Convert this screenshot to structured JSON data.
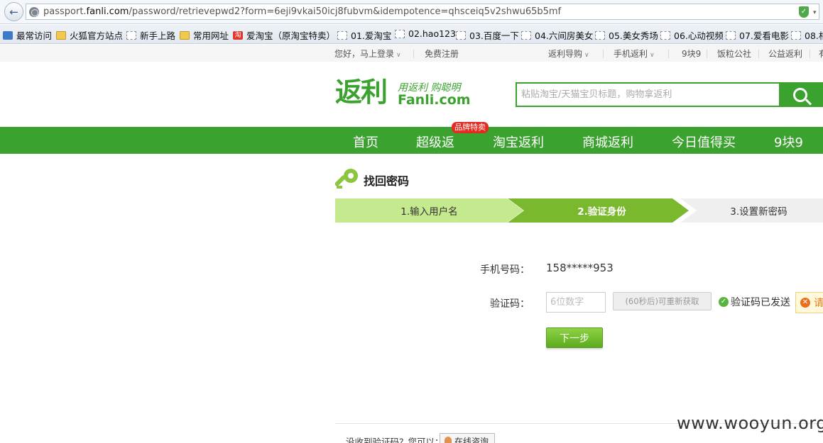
{
  "browser": {
    "url_prefix": "passport.",
    "url_host": "fanli.com",
    "url_path": "/password/retrievepwd2?form=6eji9vkai50icj8fubvm&idempotence=qhsceiq5v2shwu65b5mf"
  },
  "bookmarks": [
    {
      "label": "最常访问"
    },
    {
      "label": "火狐官方站点"
    },
    {
      "label": "新手上路"
    },
    {
      "label": "常用网址"
    },
    {
      "label": "爱淘宝（原淘宝特卖）"
    },
    {
      "label": "01.爱淘宝"
    },
    {
      "label": "02.hao123"
    },
    {
      "label": "03.百度一下"
    },
    {
      "label": "04.六间房美女"
    },
    {
      "label": "05.美女秀场"
    },
    {
      "label": "06.心动视频"
    },
    {
      "label": "07.爱看电影"
    },
    {
      "label": "08.相"
    }
  ],
  "topnav": {
    "login": "您好，马上登录",
    "register": "免费注册",
    "guide": "返利导购",
    "mobile": "手机返利",
    "nine": "9块9",
    "community": "饭粒公社",
    "charity": "公益返利",
    "more": "有"
  },
  "header": {
    "logo_text": "返利",
    "slogan": "用返利 购聪明",
    "domain": "Fanli.com",
    "search_placeholder": "粘贴淘宝/天猫宝贝标题，购物拿返利"
  },
  "mainnav": {
    "items": [
      "首页",
      "超级返",
      "淘宝返利",
      "商城返利",
      "今日值得买",
      "9块9"
    ],
    "badge": "品牌特卖"
  },
  "page": {
    "title": "找回密码",
    "steps": [
      "1.输入用户名",
      "2.验证身份",
      "3.设置新密码"
    ],
    "current_step": 2
  },
  "form": {
    "phone_label": "手机号码：",
    "phone_value": "158*****953",
    "code_label": "验证码：",
    "code_placeholder": "6位数字",
    "resend_label": "(60秒后)可重新获取",
    "sent_text": "验证码已发送",
    "tip_text": "请",
    "next_label": "下一步"
  },
  "footer": {
    "help_text": "没收到验证码？您可以：",
    "consult_label": "在线咨询"
  },
  "watermark": "www.wooyun.org",
  "colors": {
    "brand_green": "#3ba22f",
    "step_active": "#7ab82e",
    "step_done": "#c4e98e",
    "badge_red": "#e52b21"
  }
}
